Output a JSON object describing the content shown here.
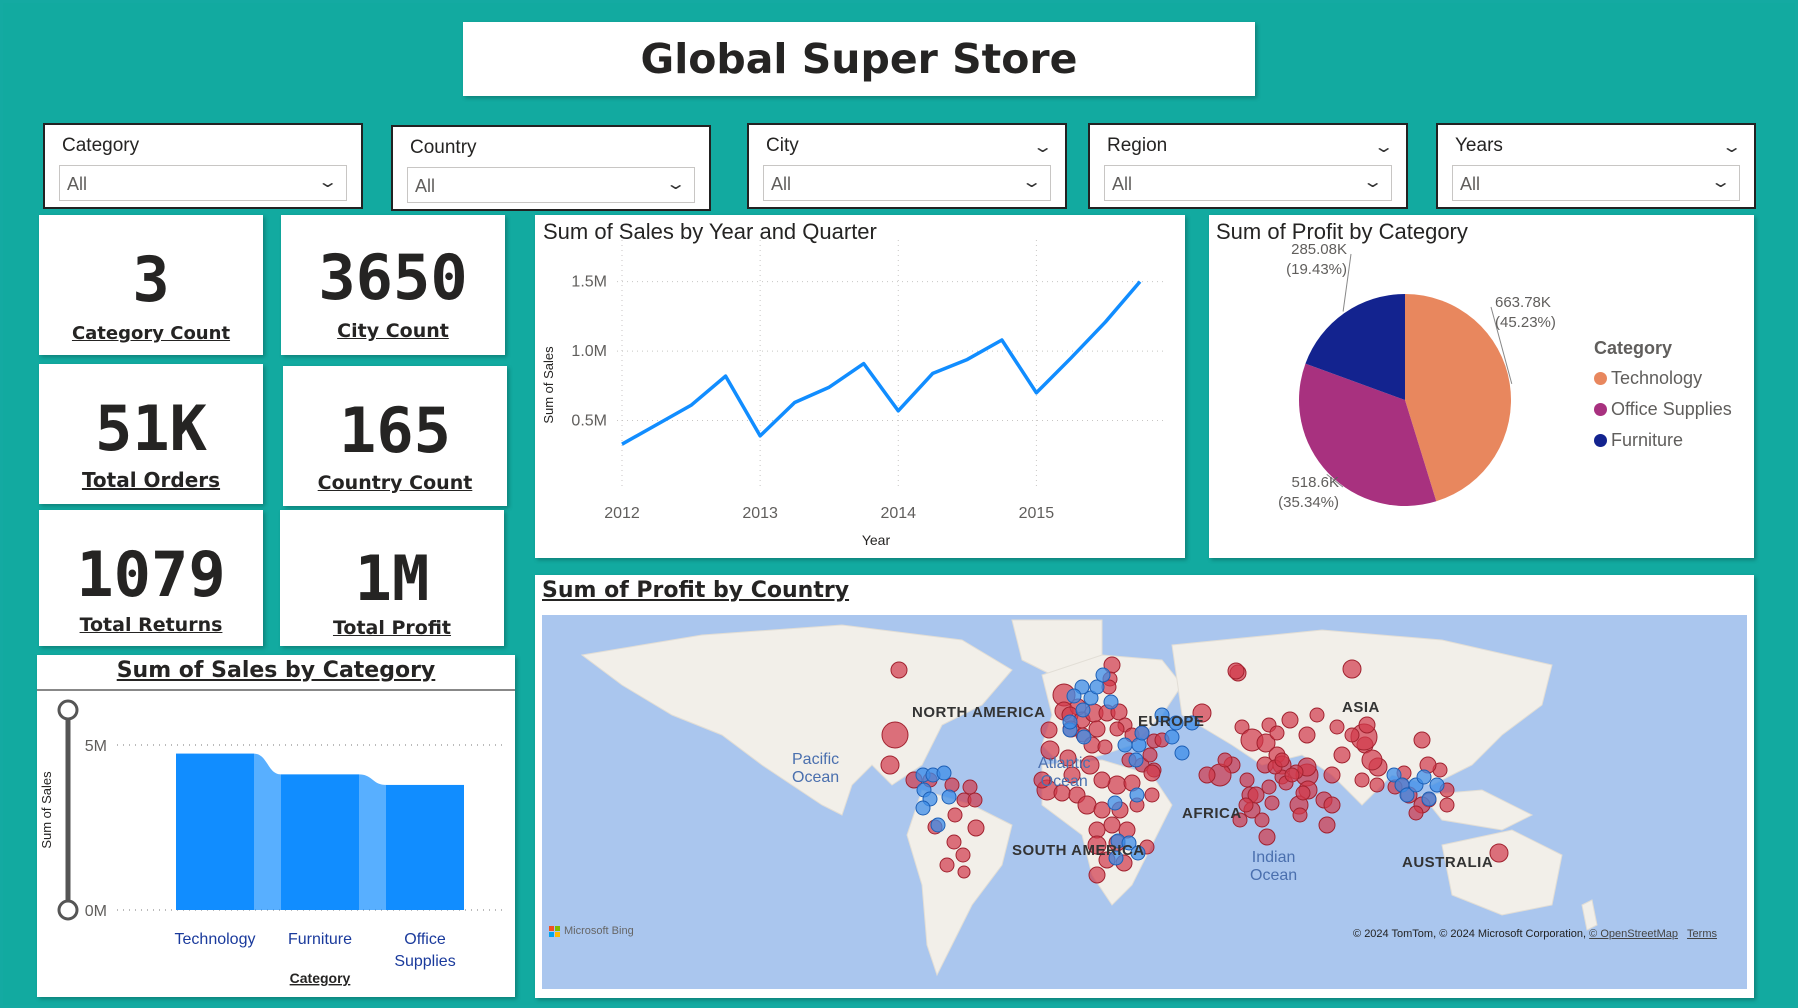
{
  "title": "Global Super Store",
  "slicers": [
    {
      "label": "Category",
      "value": "All"
    },
    {
      "label": "Country",
      "value": "All"
    },
    {
      "label": "City",
      "value": "All"
    },
    {
      "label": "Region",
      "value": "All"
    },
    {
      "label": "Years",
      "value": "All"
    }
  ],
  "kpis": {
    "category_count": {
      "value": "3",
      "label": "Category Count"
    },
    "city_count": {
      "value": "3650",
      "label": "City Count"
    },
    "total_orders": {
      "value": "51K",
      "label": "Total Orders "
    },
    "country_count": {
      "value": "165",
      "label": "Country Count"
    },
    "total_returns": {
      "value": "1079",
      "label": "Total Returns"
    },
    "total_profit": {
      "value": "1M",
      "label": "Total Profit"
    }
  },
  "line_chart": {
    "title": "Sum of Sales by Year and Quarter"
  },
  "pie_chart": {
    "title": "Sum of Profit by Category",
    "legend_title": "Category",
    "labels": [
      {
        "value": "663.78K",
        "pct": "(45.23%)"
      },
      {
        "value": "518.6K",
        "pct": "(35.34%)"
      },
      {
        "value": "285.08K",
        "pct": "(19.43%)"
      }
    ]
  },
  "bar_chart": {
    "title": "Sum of Sales by Category"
  },
  "map": {
    "title": "Sum of Profit by Country",
    "continents": [
      "NORTH AMERICA",
      "EUROPE",
      "ASIA",
      "AFRICA",
      "SOUTH AMERICA",
      "AUSTRALIA"
    ],
    "oceans": [
      "Pacific\nOcean",
      "Atlantic\nOcean",
      "Indian\nOcean"
    ],
    "brand": "Microsoft Bing",
    "attribution": "© 2024 TomTom, © 2024 Microsoft Corporation, ",
    "attribution_link": "© OpenStreetMap",
    "terms": "Terms",
    "colors": {
      "red": "#d1394a",
      "blue": "#3e8ee8",
      "water": "#aac6ee",
      "land": "#f2efe9"
    }
  },
  "colors": {
    "background": "#12aaa0",
    "line": "#118dff",
    "bar": "#118dff",
    "technology": "#e8875e",
    "office": "#a8317f",
    "furniture": "#13238f"
  },
  "chart_data": [
    {
      "type": "line",
      "title": "Sum of Sales by Year and Quarter",
      "xlabel": "Year",
      "ylabel": "Sum of Sales",
      "x_ticks": [
        "2012",
        "2013",
        "2014",
        "2015"
      ],
      "y_ticks": [
        "0.5M",
        "1.0M",
        "1.5M"
      ],
      "ylim": [
        0,
        1.8
      ],
      "x": [
        2012.0,
        2012.25,
        2012.5,
        2012.75,
        2013.0,
        2013.25,
        2013.5,
        2013.75,
        2014.0,
        2014.25,
        2014.5,
        2014.75,
        2015.0,
        2015.25,
        2015.5,
        2015.75
      ],
      "values": [
        0.33,
        0.47,
        0.61,
        0.82,
        0.39,
        0.63,
        0.74,
        0.91,
        0.57,
        0.84,
        0.94,
        1.08,
        0.7,
        0.95,
        1.21,
        1.5
      ],
      "grid": true
    },
    {
      "type": "pie",
      "title": "Sum of Profit by Category",
      "legend_title": "Category",
      "legend_position": "right",
      "categories": [
        "Technology",
        "Office Supplies",
        "Furniture"
      ],
      "values": [
        663.78,
        518.6,
        285.08
      ],
      "percentages": [
        45.23,
        35.34,
        19.43
      ]
    },
    {
      "type": "bar",
      "title": "Sum of Sales by Category",
      "xlabel": "Category",
      "ylabel": "Sum of Sales",
      "categories": [
        "Technology",
        "Furniture",
        "Office\nSupplies"
      ],
      "values": [
        4.74,
        4.11,
        3.79
      ],
      "y_ticks": [
        "0M",
        "5M"
      ],
      "ylim": [
        0,
        5
      ]
    }
  ]
}
